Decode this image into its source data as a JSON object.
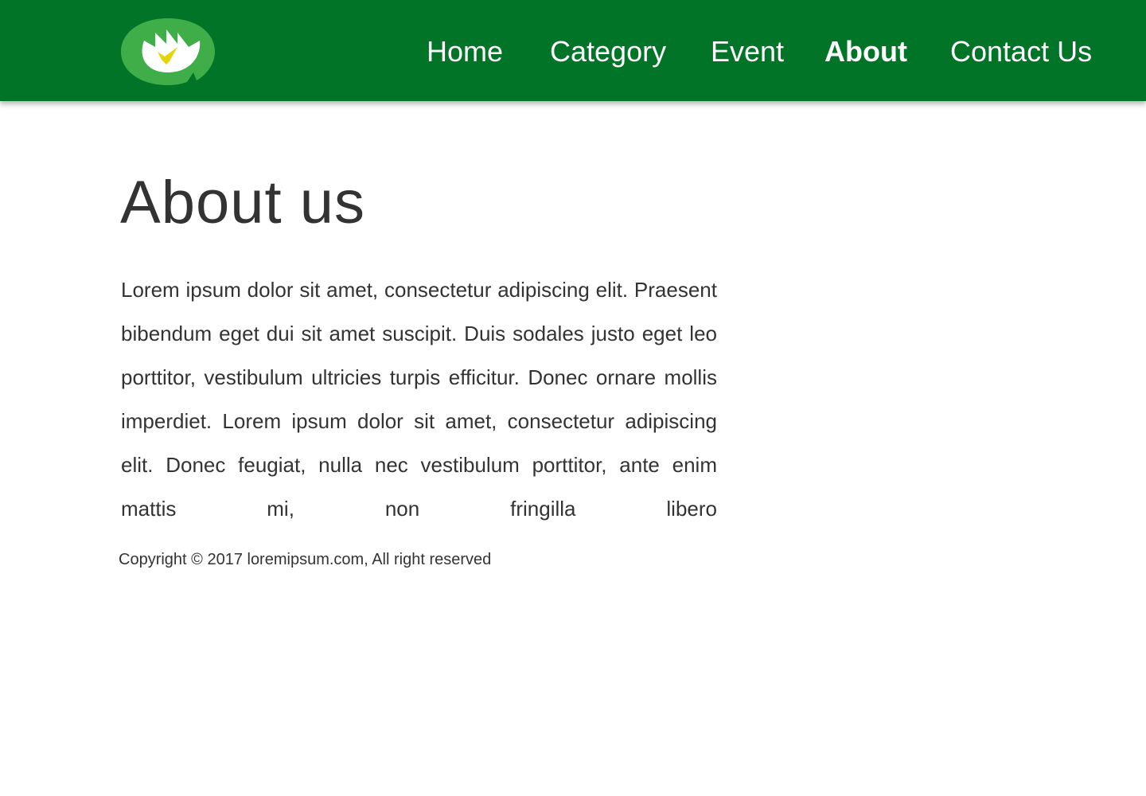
{
  "brand": {
    "logo_icon": "lotus-leaf-icon",
    "colors": {
      "header_bg": "#017428",
      "leaf": "#3FAE49",
      "petals": "#FFFFFF",
      "center": "#E4D40A"
    }
  },
  "nav": {
    "items": [
      {
        "label": "Home",
        "active": false
      },
      {
        "label": "Category",
        "active": false
      },
      {
        "label": "Event",
        "active": false
      },
      {
        "label": "About",
        "active": true
      },
      {
        "label": "Contact Us",
        "active": false
      }
    ]
  },
  "main": {
    "title": "About us",
    "body": "Lorem ipsum dolor sit amet, consectetur adipiscing elit. Praesent bibendum eget dui sit amet suscipit. Duis sodales justo eget leo porttitor, vestibulum ultricies turpis efficitur. Donec ornare mollis imperdiet. Lorem ipsum dolor sit amet, consectetur adipiscing elit. Donec feugiat, nulla nec vestibulum porttitor, ante enim mattis mi, non fringilla libero"
  },
  "footer": {
    "copyright": "Copyright © 2017 loremipsum.com, All right reserved"
  }
}
